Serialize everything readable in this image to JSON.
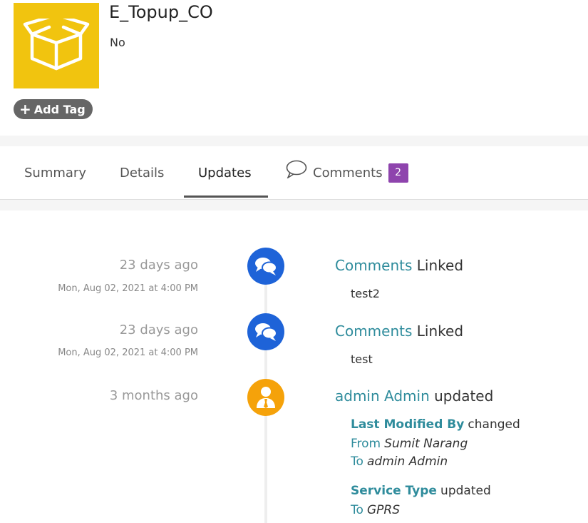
{
  "record": {
    "title": "E_Topup_CO",
    "subtitle": "No",
    "icon": "box-icon",
    "icon_color": "#f1c40f",
    "add_tag_label": "Add Tag"
  },
  "tabs": [
    {
      "label": "Summary"
    },
    {
      "label": "Details"
    },
    {
      "label": "Updates",
      "active": true
    },
    {
      "label": "Comments",
      "badge": "2",
      "icon": "chat-bubble-icon"
    }
  ],
  "updates": [
    {
      "relative_time": "23 days ago",
      "absolute_time": "Mon, Aug 02, 2021 at 4:00 PM",
      "icon": "comments-icon",
      "icon_color": "#1e63d8",
      "head_link": "Comments",
      "head_text": "Linked",
      "body": "test2"
    },
    {
      "relative_time": "23 days ago",
      "absolute_time": "Mon, Aug 02, 2021 at 4:00 PM",
      "icon": "comments-icon",
      "icon_color": "#1e63d8",
      "head_link": "Comments",
      "head_text": "Linked",
      "body": "test"
    },
    {
      "relative_time": "3 months ago",
      "icon": "user-icon",
      "icon_color": "#f5a20a",
      "head_link": "admin Admin",
      "head_text": "updated",
      "changes": [
        {
          "field": "Last Modified By",
          "verb": "changed",
          "from_label": "From",
          "from": "Sumit Narang",
          "to_label": "To",
          "to": "admin Admin"
        },
        {
          "field": "Service Type",
          "verb": "updated",
          "to_label": "To",
          "to": "GPRS"
        }
      ]
    }
  ]
}
